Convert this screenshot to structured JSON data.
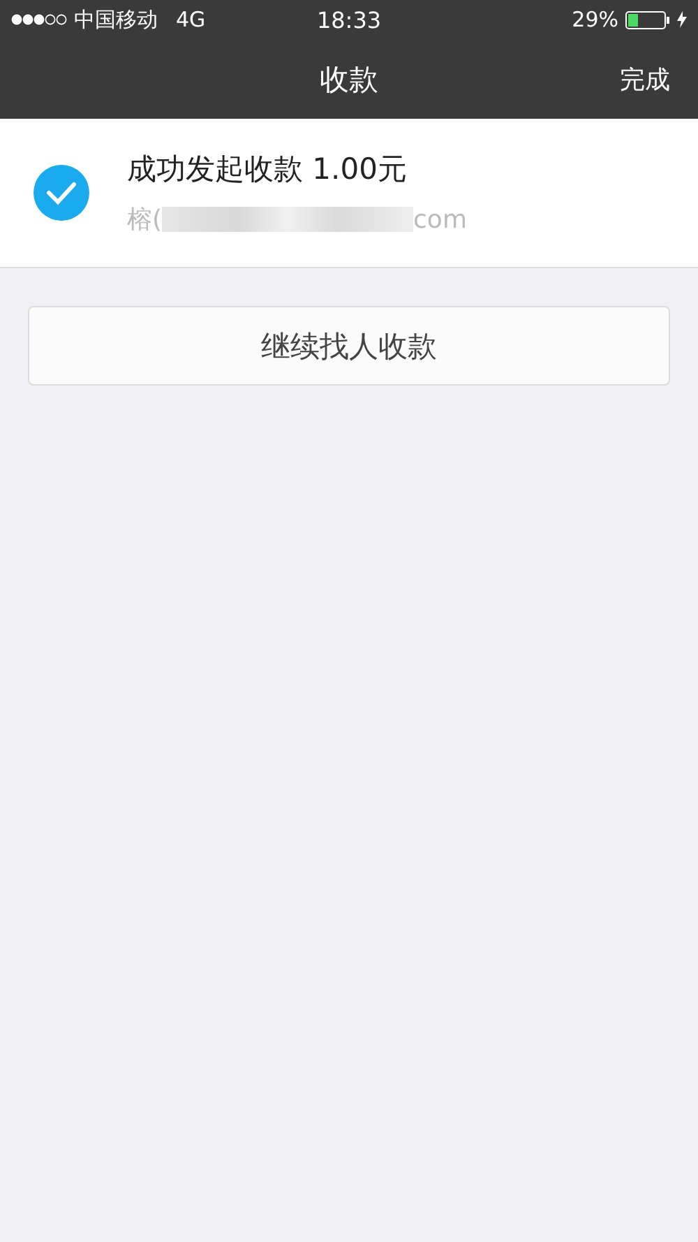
{
  "status_bar": {
    "carrier": "中国移动",
    "network": "4G",
    "time": "18:33",
    "battery": "29%"
  },
  "nav": {
    "title": "收款",
    "action": "完成"
  },
  "result": {
    "checked": true,
    "message": "成功发起收款 1.00元",
    "account_prefix": "榕(",
    "account_suffix": "com"
  },
  "button": {
    "label": "继续找人收款"
  }
}
